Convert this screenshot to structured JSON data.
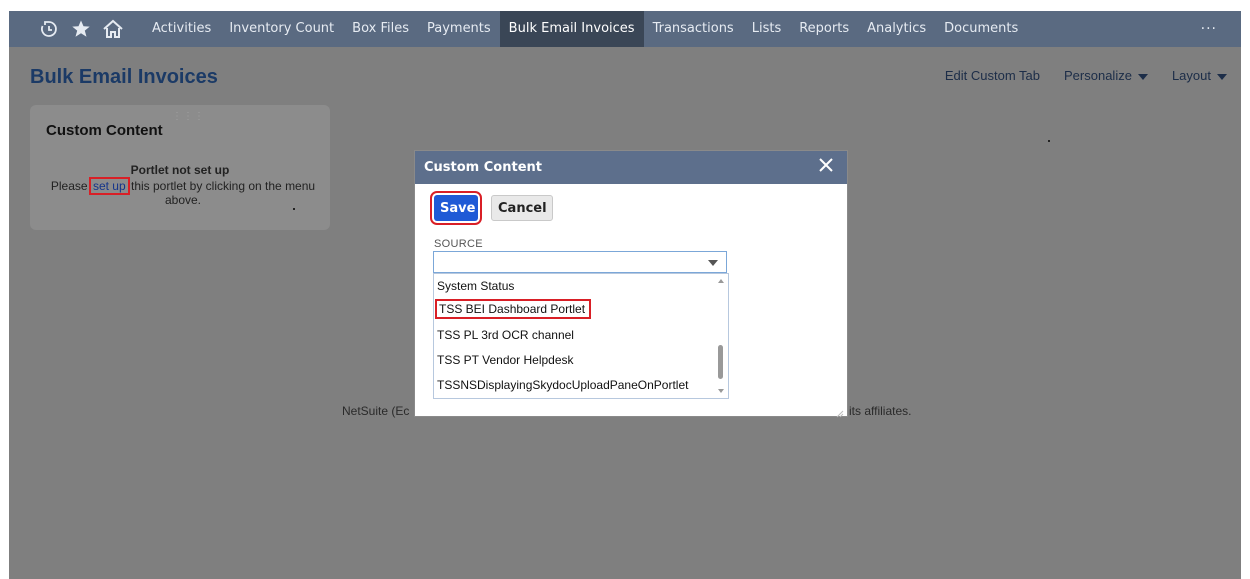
{
  "nav": {
    "icons": [
      "recent-icon",
      "star-icon",
      "home-icon"
    ],
    "items": [
      {
        "label": "Activities"
      },
      {
        "label": "Inventory Count"
      },
      {
        "label": "Box Files"
      },
      {
        "label": "Payments"
      },
      {
        "label": "Bulk Email Invoices",
        "active": true
      },
      {
        "label": "Transactions"
      },
      {
        "label": "Lists"
      },
      {
        "label": "Reports"
      },
      {
        "label": "Analytics"
      },
      {
        "label": "Documents"
      }
    ],
    "more_label": "···"
  },
  "page": {
    "title": "Bulk Email Invoices",
    "edit_custom_tab": "Edit Custom Tab",
    "personalize": "Personalize",
    "layout": "Layout"
  },
  "portlet": {
    "title": "Custom Content",
    "msg_title": "Portlet not set up",
    "msg_before": "Please",
    "msg_link": "set up",
    "msg_after": "this portlet by clicking on the menu above."
  },
  "footer": {
    "left": "NetSuite (Ec",
    "right": "its affiliates."
  },
  "dialog": {
    "title": "Custom Content",
    "save_label": "Save",
    "cancel_label": "Cancel",
    "source_label": "SOURCE",
    "source_value": "",
    "options": [
      "System Status",
      "TSS BEI Dashboard Portlet",
      "TSS PL 3rd OCR channel",
      "TSS PT Vendor Helpdesk",
      "TSSNSDisplayingSkydocUploadPaneOnPortlet"
    ],
    "highlighted_option": "TSS BEI Dashboard Portlet"
  },
  "colors": {
    "nav_bg": "#5a6a81",
    "nav_active": "#3a4656",
    "overlay": "#7f7f7f",
    "dialog_header": "#5d6f8c",
    "save_button": "#1f5ad6",
    "highlight": "#d91f26"
  }
}
